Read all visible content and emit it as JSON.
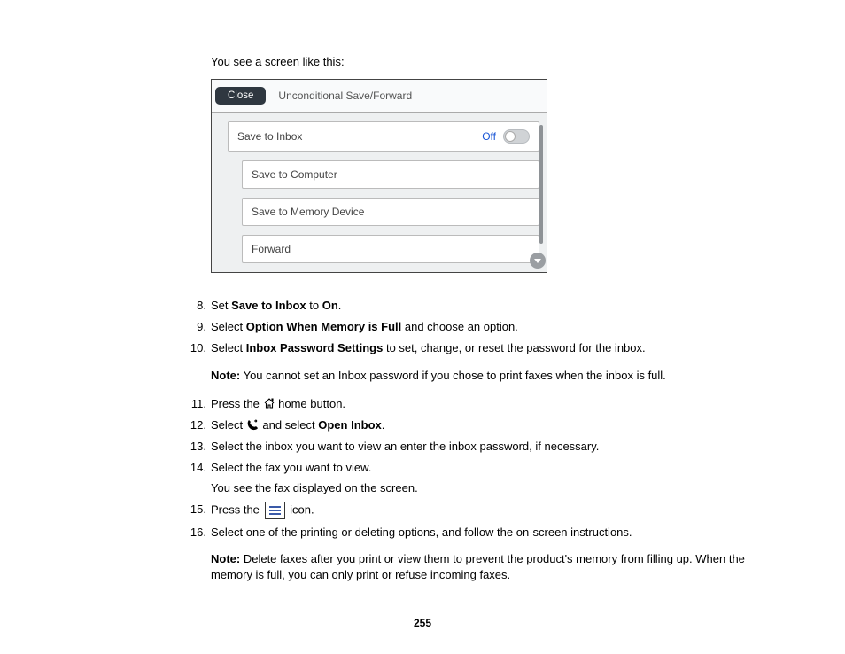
{
  "intro": "You see a screen like this:",
  "device": {
    "close": "Close",
    "title": "Unconditional Save/Forward",
    "rows": {
      "save_inbox": "Save to Inbox",
      "off": "Off",
      "save_computer": "Save to Computer",
      "save_memory": "Save to Memory Device",
      "forward": "Forward"
    }
  },
  "steps": {
    "s8a": "Set ",
    "s8b": "Save to Inbox",
    "s8c": " to ",
    "s8d": "On",
    "s8e": ".",
    "s9a": "Select ",
    "s9b": "Option When Memory is Full",
    "s9c": " and choose an option.",
    "s10a": "Select ",
    "s10b": "Inbox Password Settings",
    "s10c": " to set, change, or reset the password for the inbox.",
    "note1_label": "Note:",
    "note1_text": " You cannot set an Inbox password if you chose to print faxes when the inbox is full.",
    "s11a": "Press the ",
    "s11b": " home button.",
    "s12a": "Select ",
    "s12b": " and select ",
    "s12c": "Open Inbox",
    "s12d": ".",
    "s13": "Select the inbox you want to view an enter the inbox password, if necessary.",
    "s14": "Select the fax you want to view.",
    "s14sub": "You see the fax displayed on the screen.",
    "s15a": "Press the ",
    "s15b": " icon.",
    "s16": "Select one of the printing or deleting options, and follow the on-screen instructions.",
    "note2_label": "Note:",
    "note2_text": " Delete faxes after you print or view them to prevent the product's memory from filling up. When the memory is full, you can only print or refuse incoming faxes."
  },
  "page_number": "255"
}
